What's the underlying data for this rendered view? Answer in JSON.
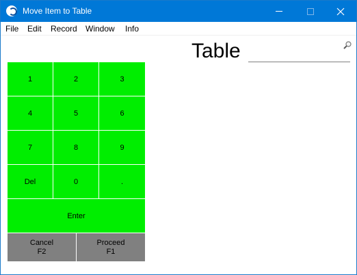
{
  "window": {
    "title": "Move Item to Table",
    "icon": "app-icon",
    "controls": {
      "minimize": "minimize-icon",
      "maximize": "maximize-icon",
      "close": "close-icon"
    }
  },
  "menubar": {
    "items": [
      {
        "label": "File"
      },
      {
        "label": "Edit"
      },
      {
        "label": "Record"
      },
      {
        "label": "Window"
      },
      {
        "label": "Info"
      }
    ]
  },
  "form": {
    "table_label": "Table",
    "table_value": "",
    "search_icon": "search-icon"
  },
  "keypad": {
    "keys": [
      "1",
      "2",
      "3",
      "4",
      "5",
      "6",
      "7",
      "8",
      "9",
      "Del",
      "0",
      "."
    ],
    "enter_label": "Enter",
    "cancel": {
      "label": "Cancel",
      "shortcut": "F2"
    },
    "proceed": {
      "label": "Proceed",
      "shortcut": "F1"
    }
  },
  "colors": {
    "titlebar": "#0078d7",
    "key_green": "#00ee00",
    "key_gray": "#808080"
  }
}
